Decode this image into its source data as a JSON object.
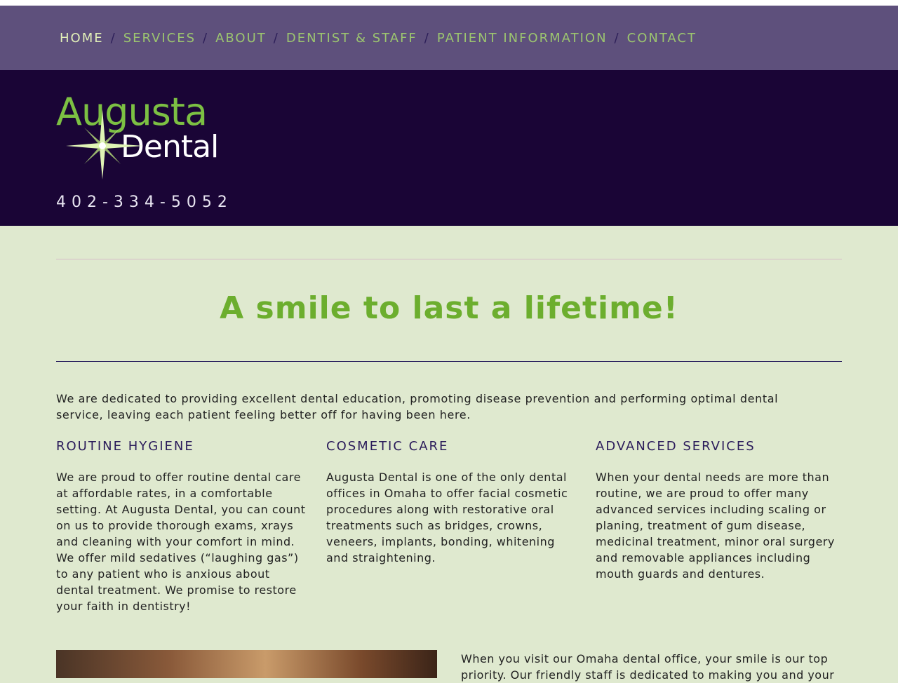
{
  "nav": {
    "items": [
      {
        "label": "HOME",
        "active": true
      },
      {
        "label": "SERVICES",
        "active": false
      },
      {
        "label": "ABOUT",
        "active": false
      },
      {
        "label": "DENTIST & STAFF",
        "active": false
      },
      {
        "label": "PATIENT INFORMATION",
        "active": false
      },
      {
        "label": "CONTACT",
        "active": false
      }
    ],
    "separator": "/"
  },
  "header": {
    "logo_word1": "Augusta",
    "logo_word2": "Dental",
    "phone": "402-334-5052"
  },
  "main": {
    "headline": "A smile to last a lifetime!",
    "intro": "We are dedicated to providing excellent dental education, promoting disease prevention and performing optimal dental service, leaving each patient feeling better off for having been here.",
    "columns": [
      {
        "title": "ROUTINE HYGIENE",
        "body": "We are proud to offer routine dental care at affordable rates, in a comfortable setting.  At Augusta Dental, you can count on us to provide thorough exams, xrays and cleaning with your comfort in mind.  We offer mild sedatives (“laughing gas”) to any patient who is anxious about dental treatment.  We promise to restore your faith in dentistry!"
      },
      {
        "title": "COSMETIC CARE",
        "body": "Augusta Dental is one of the only dental offices in Omaha to offer facial cosmetic procedures along with restorative oral treatments such as bridges, crowns, veneers, implants, bonding, whitening and straightening."
      },
      {
        "title": "ADVANCED SERVICES",
        "body": "When your dental needs are more than routine, we are proud to offer many advanced services including scaling or planing, treatment of gum disease, medicinal treatment, minor oral surgery and removable appliances including mouth guards and dentures."
      }
    ],
    "visit_text": "When you visit our Omaha dental office, your smile is our top priority. Our friendly staff is dedicated to making you and your"
  },
  "colors": {
    "nav_bg": "#5e507c",
    "nav_link": "#9cc56f",
    "header_bg": "#1a0536",
    "page_bg": "#dfe9cf",
    "accent_green": "#6cae2e",
    "heading_purple": "#2a1b5a"
  }
}
